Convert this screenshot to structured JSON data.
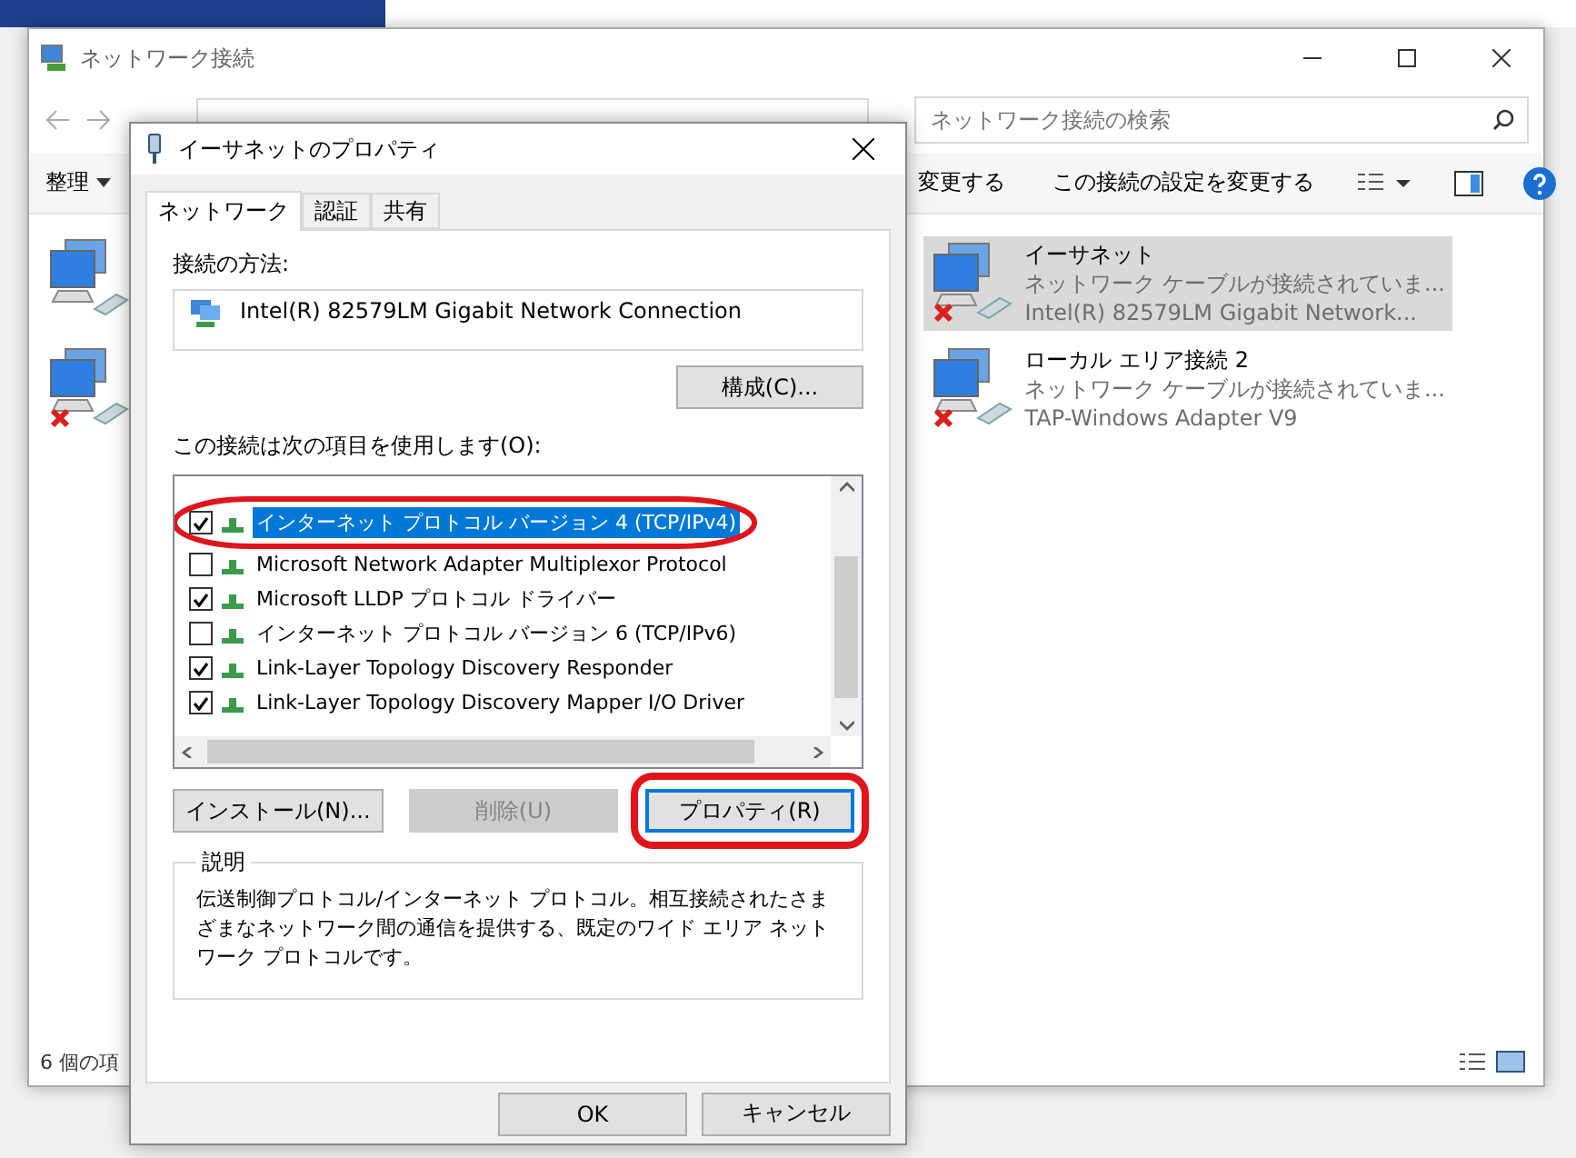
{
  "explorer": {
    "title": "ネットワーク接続",
    "search": {
      "placeholder": "ネットワーク接続の検索"
    },
    "toolbar": [
      {
        "kind": "menu",
        "label": "整理"
      },
      {
        "kind": "command",
        "label": "変更する"
      },
      {
        "kind": "command",
        "label": "この接続の設定を変更する"
      }
    ],
    "hidden_connections": [
      {
        "disconnected": false
      },
      {
        "disconnected": true
      }
    ],
    "connections": [
      {
        "name": "イーサネット",
        "status": "ネットワーク ケーブルが接続されていま...",
        "adapter": "Intel(R) 82579LM Gigabit Network...",
        "selected": true,
        "disconnected": true
      },
      {
        "name": "ローカル エリア接続 2",
        "status": "ネットワーク ケーブルが接続されていま...",
        "adapter": "TAP-Windows Adapter V9",
        "selected": false,
        "disconnected": true
      }
    ],
    "status_bar": "6 個の項"
  },
  "dialog": {
    "title": "イーサネットのプロパティ",
    "tabs": [
      {
        "label": "ネットワーク",
        "selected": true
      },
      {
        "label": "認証",
        "selected": false
      },
      {
        "label": "共有",
        "selected": false
      }
    ],
    "connect_using_label": "接続の方法:",
    "adapter": "Intel(R) 82579LM Gigabit Network Connection",
    "configure_button": "構成(C)...",
    "items_label": "この接続は次の項目を使用します(O):",
    "items": [
      {
        "label": "インターネット プロトコル バージョン 4 (TCP/IPv4)",
        "checked": true,
        "selected": true,
        "highlighted": true
      },
      {
        "label": "Microsoft Network Adapter Multiplexor Protocol",
        "checked": false,
        "selected": false,
        "highlighted": false
      },
      {
        "label": "Microsoft LLDP プロトコル ドライバー",
        "checked": true,
        "selected": false,
        "highlighted": false
      },
      {
        "label": "インターネット プロトコル バージョン 6 (TCP/IPv6)",
        "checked": false,
        "selected": false,
        "highlighted": false
      },
      {
        "label": "Link-Layer Topology Discovery Responder",
        "checked": true,
        "selected": false,
        "highlighted": false
      },
      {
        "label": "Link-Layer Topology Discovery Mapper I/O Driver",
        "checked": true,
        "selected": false,
        "highlighted": false
      }
    ],
    "buttons": [
      {
        "label": "インストール(N)...",
        "disabled": false,
        "focused": false,
        "highlighted": false
      },
      {
        "label": "削除(U)",
        "disabled": true,
        "focused": false,
        "highlighted": false
      },
      {
        "label": "プロパティ(R)",
        "disabled": false,
        "focused": true,
        "highlighted": true
      }
    ],
    "description_label": "説明",
    "description": "伝送制御プロトコル/インターネット プロトコル。相互接続されたさまざまなネットワーク間の通信を提供する、既定のワイド エリア ネットワーク プロトコルです。",
    "footer_buttons": [
      "OK",
      "キャンセル"
    ]
  }
}
